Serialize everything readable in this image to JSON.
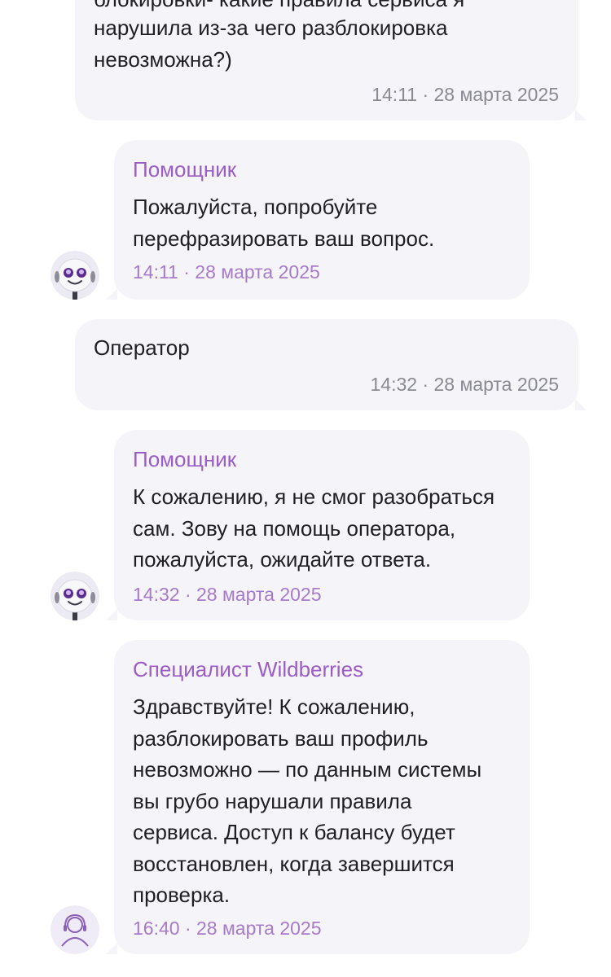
{
  "messages": [
    {
      "text_top_cut": "блокировки- какие правила сервиса я",
      "text": "нарушила из-за чего разблокировка\nневозможна?)",
      "time": "14:11 · 28 марта 2025"
    },
    {
      "sender": "Помощник",
      "text": "Пожалуйста, попробуйте\nперефразировать ваш вопрос.",
      "time": "14:11 · 28 марта 2025",
      "avatar_icon": "robot-avatar-icon"
    },
    {
      "text": "Оператор",
      "time": "14:32 · 28 марта 2025"
    },
    {
      "sender": "Помощник",
      "text": "К сожалению, я не смог разобраться\nсам. Зову на помощь оператора,\nпожалуйста, ожидайте ответа.",
      "time": "14:32 · 28 марта 2025",
      "avatar_icon": "robot-avatar-icon"
    },
    {
      "sender": "Специалист Wildberries",
      "text": "Здравствуйте! К сожалению,\nразблокировать ваш профиль\nневозможно — по данным системы\nвы грубо нарушали правила\nсервиса. Доступ к балансу будет\nвосстановлен, когда завершится\nпроверка.",
      "time": "16:40 · 28 марта 2025",
      "avatar_icon": "support-agent-icon"
    }
  ],
  "colors": {
    "bubble_bg": "#f5f4f8",
    "sender_accent": "#9b5cc6",
    "incoming_time": "#a77acb",
    "outgoing_time": "#8a8a93"
  }
}
